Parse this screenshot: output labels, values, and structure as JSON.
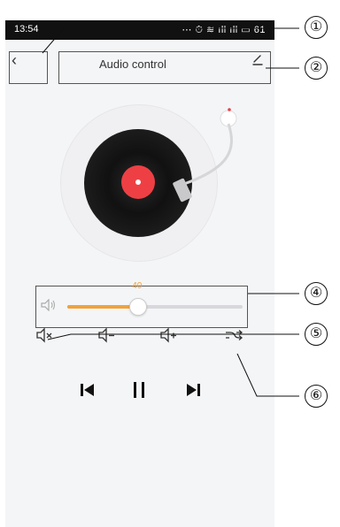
{
  "status_bar": {
    "time": "13:54",
    "right_text": "⋯ ⏱ ≋ ıll ıll ▭ 61"
  },
  "header": {
    "title": "Audio control"
  },
  "volume": {
    "value_text": "40",
    "level_percent": 40
  },
  "callouts": [
    "①",
    "②",
    "④",
    "⑤",
    "⑥"
  ],
  "icons": {
    "back": "back-chevron-icon",
    "edit": "edit-pencil-icon",
    "volume": "speaker-icon",
    "mute": "mute-icon",
    "volume_down": "volume-down-icon",
    "volume_up": "volume-up-icon",
    "shuffle": "shuffle-icon",
    "previous": "previous-track-icon",
    "pause": "pause-icon",
    "next": "next-track-icon"
  },
  "colors": {
    "accent": "#f0a23b",
    "record_label": "#ee4044"
  }
}
